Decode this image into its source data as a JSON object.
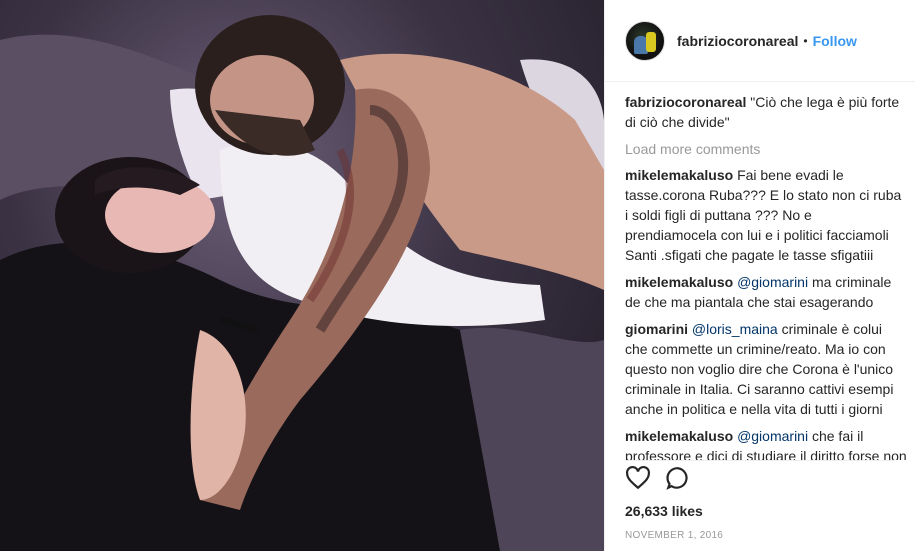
{
  "post": {
    "username": "fabriziocoronareal",
    "follow_label": "Follow",
    "separator": "•",
    "caption": "\"Ciò che lega è più forte di ciò che divide\"",
    "load_more": "Load more comments",
    "likes": "26,633 likes",
    "date": "NOVEMBER 1, 2016"
  },
  "comments": [
    {
      "user": "mikelemakaluso",
      "mention": "",
      "text": "Fai bene evadi le tasse.corona Ruba??? E lo stato non ci ruba i soldi figli di puttana ??? No e prendiamocela con lui e i politici facciamoli Santi .sfigati che pagate le tasse sfigatiii"
    },
    {
      "user": "mikelemakaluso",
      "mention": "@giomarini",
      "text": "ma criminale de che ma piantala che stai esagerando"
    },
    {
      "user": "giomarini",
      "mention": "@loris_maina",
      "text": "criminale è colui che commette un crimine/reato. Ma io con questo non voglio dire che Corona è l'unico criminale in Italia. Ci saranno cattivi esempi anche in politica e nella vita di tutti i giorni"
    },
    {
      "user": "mikelemakaluso",
      "mention": "@giomarini",
      "text": "che fai il professore e dici di studiare il diritto forse non hai capito ,è proprio quello che va male e dovrebbe essere rivisto, se abbiamo"
    }
  ],
  "icons": {
    "like": "heart-icon",
    "comment": "comment-bubble-icon"
  }
}
